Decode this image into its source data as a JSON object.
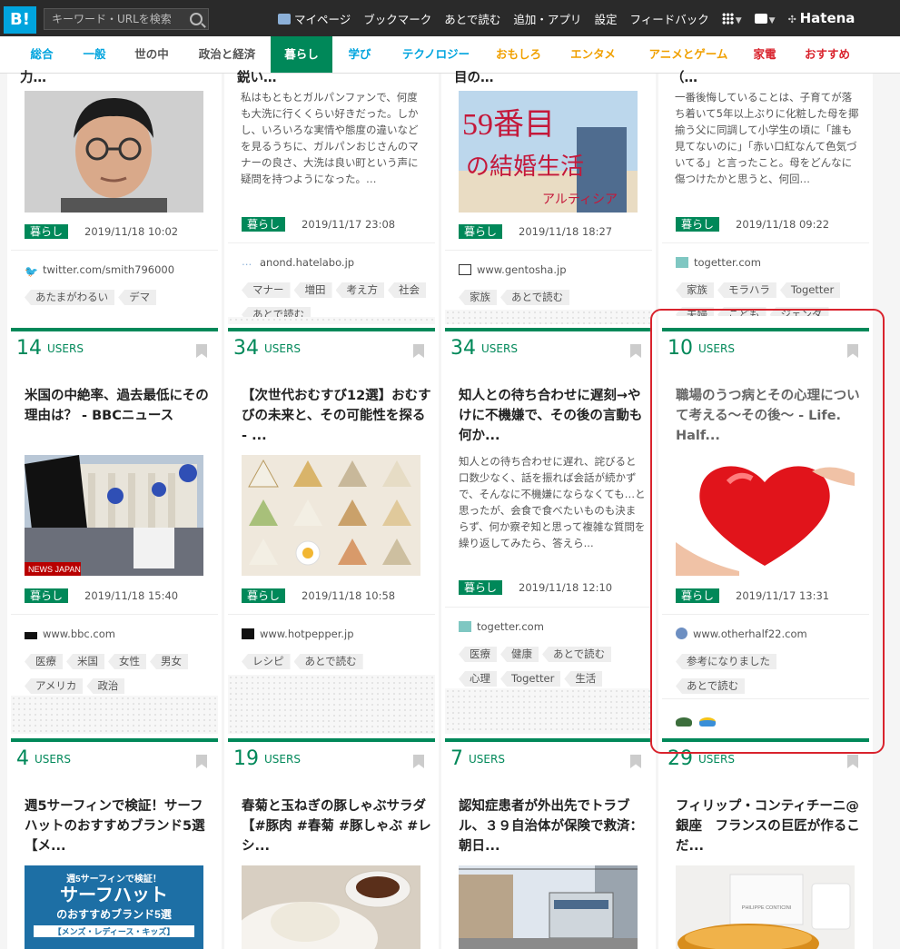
{
  "header": {
    "logo": "B!",
    "search_placeholder": "キーワード・URLを検索",
    "nav": [
      "マイページ",
      "ブックマーク",
      "あとで読む",
      "追加・アプリ",
      "設定",
      "フィードバック"
    ],
    "brand": "Hatena"
  },
  "categories": [
    {
      "label": "総合",
      "color": "#00a4de"
    },
    {
      "label": "一般",
      "color": "#00a4de"
    },
    {
      "label": "世の中",
      "color": "#555555"
    },
    {
      "label": "政治と経済",
      "color": "#555555"
    },
    {
      "label": "暮らし",
      "color": "#ffffff"
    },
    {
      "label": "学び",
      "color": "#00a4de"
    },
    {
      "label": "テクノロジー",
      "color": "#00a4de"
    },
    {
      "label": "おもしろ",
      "color": "#f0a000"
    },
    {
      "label": "エンタメ",
      "color": "#f0a000"
    },
    {
      "label": "アニメとゲーム",
      "color": "#f0a000"
    },
    {
      "label": "家電",
      "color": "#d9232d"
    },
    {
      "label": "おすすめ",
      "color": "#d9232d"
    }
  ],
  "users_label": "USERS",
  "top_row": [
    {
      "partial_title": "力…",
      "tag": "暮らし",
      "date": "2019/11/18 10:02",
      "source": "twitter.com/smith796000",
      "tags": [
        "あたまがわるい",
        "デマ"
      ]
    },
    {
      "partial_title": "鋭い…",
      "desc": "私はもともとガルパンファンで、何度も大洗に行くくらい好きだった。しかし、いろいろな実情や態度の違いなどを見るうちに、ガルパンおじさんのマナーの良さ、大洗は良い町という声に疑問を持つようになった。…",
      "tag": "暮らし",
      "date": "2019/11/17 23:08",
      "source": "anond.hatelabo.jp",
      "tags": [
        "マナー",
        "増田",
        "考え方",
        "社会",
        "あとで読む"
      ]
    },
    {
      "partial_title": "目の…",
      "thumb_text": [
        "59番目",
        "の結婚生活",
        "アルティシア"
      ],
      "tag": "暮らし",
      "date": "2019/11/18 18:27",
      "source": "www.gentosha.jp",
      "tags": [
        "家族",
        "あとで読む"
      ]
    },
    {
      "partial_title": "（…",
      "desc": "一番後悔していることは、子育てが落ち着いて5年以上ぶりに化粧した母を揶揄う父に同調して小学生の頃に「誰も見てないのに」「赤い口紅なんて色気づいてる」と言ったこと。母をどんなに傷つけたかと思うと、何回…",
      "tag": "暮らし",
      "date": "2019/11/18 09:22",
      "source": "togetter.com",
      "tags": [
        "家族",
        "モラハラ",
        "Togetter",
        "夫婦",
        "こども",
        "ジェンダ"
      ]
    }
  ],
  "middle_row": [
    {
      "users": "14",
      "title": "米国の中絶率、過去最低にその理由は？ - BBCニュース",
      "thumb_text": "NEWS JAPAN",
      "tag": "暮らし",
      "date": "2019/11/18 15:40",
      "source": "www.bbc.com",
      "tags": [
        "医療",
        "米国",
        "女性",
        "男女",
        "アメリカ",
        "政治"
      ]
    },
    {
      "users": "34",
      "title": "【次世代おむすび12選】おむすびの未来と、その可能性を探る - ...",
      "tag": "暮らし",
      "date": "2019/11/18 10:58",
      "source": "www.hotpepper.jp",
      "tags": [
        "レシピ",
        "あとで読む"
      ]
    },
    {
      "users": "34",
      "title": "知人との待ち合わせに遅刻→やけに不機嫌で、その後の言動も何か...",
      "desc": "知人との待ち合わせに遅れ、詫びると口数少なく、話を振れば会話が続かずで、そんなに不機嫌にならなくても…と思ったが、会食で食べたいものも決まらず、何か察ぞ知と思って複雑な質問を繰り返してみたら、答えら...",
      "tag": "暮らし",
      "date": "2019/11/18 12:10",
      "source": "togetter.com",
      "tags": [
        "医療",
        "健康",
        "あとで読む",
        "心理",
        "Togetter",
        "生活"
      ]
    },
    {
      "users": "10",
      "title": "職場のうつ病とその心理について考える〜その後〜 - Life. Half...",
      "tag": "暮らし",
      "date": "2019/11/17 13:31",
      "source": "www.otherhalf22.com",
      "tags": [
        "参考になりました",
        "あとで読む"
      ]
    }
  ],
  "bottom_row": [
    {
      "users": "4",
      "title": "週5サーフィンで検証！サーフハットのおすすめブランド5選【メ...",
      "thumb_lines": [
        "週5サーフィンで検証！",
        "サーフハット",
        "のおすすめブランド5選",
        "【メンズ・レディース・キッズ】"
      ]
    },
    {
      "users": "19",
      "title": "春菊と玉ねぎの豚しゃぶサラダ【#豚肉 #春菊 #豚しゃぶ #レシ..."
    },
    {
      "users": "7",
      "title": "認知症患者が外出先でトラブル、３９自治体が保険で救済：朝日..."
    },
    {
      "users": "29",
      "title": "フィリップ・コンティチーニ@銀座　フランスの巨匠が作るこだ...",
      "thumb_text": "PHILIPPE CONTICINI"
    }
  ]
}
